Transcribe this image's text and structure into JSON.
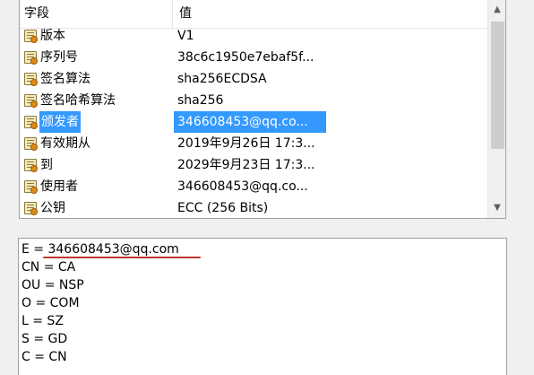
{
  "list": {
    "headers": {
      "field": "字段",
      "value": "值"
    },
    "rows": [
      {
        "field": "版本",
        "value": "V1"
      },
      {
        "field": "序列号",
        "value": "38c6c1950e7ebaf5f..."
      },
      {
        "field": "签名算法",
        "value": "sha256ECDSA"
      },
      {
        "field": "签名哈希算法",
        "value": "sha256"
      },
      {
        "field": "颁发者",
        "value": "346608453@qq.co..."
      },
      {
        "field": "有效期从",
        "value": "2019年9月26日 17:3..."
      },
      {
        "field": "到",
        "value": "2029年9月23日 17:3..."
      },
      {
        "field": "使用者",
        "value": "346608453@qq.co..."
      },
      {
        "field": "公钥",
        "value": "ECC (256 Bits)"
      }
    ],
    "selected_row": "颁发者",
    "scroll": {
      "up_arrow": "▲",
      "down_arrow": "▼"
    }
  },
  "detail": {
    "lines": [
      "E = 346608453@qq.com",
      "CN = CA",
      "OU = NSP",
      "O = COM",
      "L = SZ",
      "S = GD",
      "C = CN"
    ]
  },
  "colors": {
    "selection": "#3399ff",
    "annotation_underline": "#c0392b"
  },
  "icons": {
    "row_icon": "certificate-field-icon"
  }
}
